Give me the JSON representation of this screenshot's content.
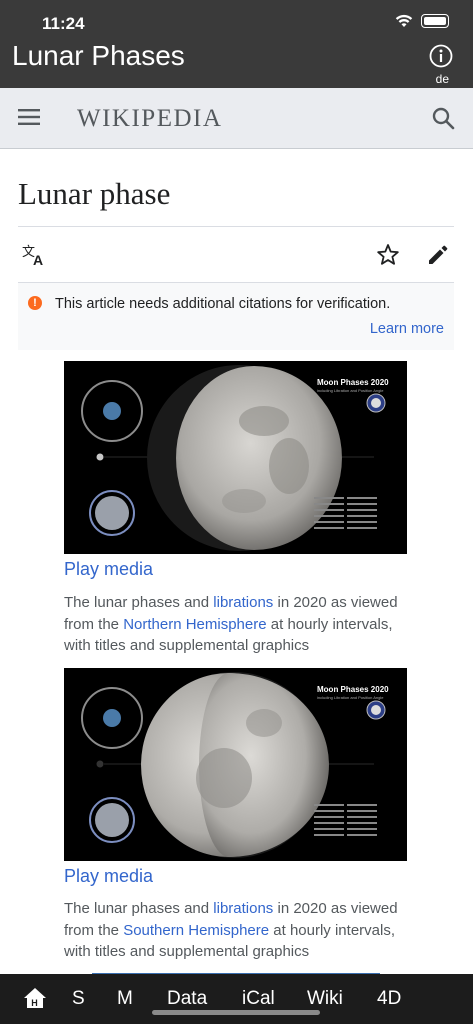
{
  "status_bar": {
    "time": "11:24"
  },
  "app_bar": {
    "title": "Lunar Phases",
    "lang": "de"
  },
  "header": {
    "logo": "Wikipedia",
    "logo_display": "WIKIPEDIA"
  },
  "article": {
    "title": "Lunar phase",
    "notice": {
      "text": "This article needs additional citations for verification.",
      "link": "Learn more"
    },
    "media": [
      {
        "overlay_title": "Moon Phases 2020",
        "overlay_sub": "including Libration and Position Angle",
        "play_label": "Play media",
        "caption_before": "The lunar phases and ",
        "caption_link1": "librations",
        "caption_middle": " in 2020 as viewed from the ",
        "caption_link2": "Northern Hemisphere",
        "caption_after": " at hourly intervals, with titles and supplemental graphics"
      },
      {
        "overlay_title": "Moon Phases 2020",
        "overlay_sub": "including Libration and Position Angle",
        "play_label": "Play media",
        "caption_before": "The lunar phases and ",
        "caption_link1": "librations",
        "caption_middle": " in 2020 as viewed from the ",
        "caption_link2": "Southern Hemisphere",
        "caption_after": " at hourly intervals, with titles and supplemental graphics"
      }
    ]
  },
  "tabbar": {
    "items": [
      "S",
      "M",
      "Data",
      "iCal",
      "Wiki",
      "4D"
    ]
  },
  "colors": {
    "link": "#3366cc",
    "notice": "#fc6a1e",
    "appbar": "#3a3a3a"
  },
  "icons": [
    "home-icon",
    "info-icon",
    "menu-icon",
    "search-icon",
    "translate-icon",
    "star-icon",
    "edit-icon",
    "warning-icon"
  ]
}
